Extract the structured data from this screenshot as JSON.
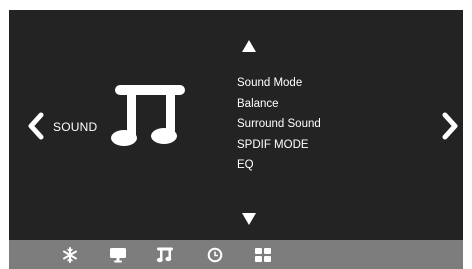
{
  "menu": {
    "section_label": "SOUND",
    "section_icon": "music-note-icon",
    "items": [
      {
        "label": "Sound Mode"
      },
      {
        "label": "Balance"
      },
      {
        "label": "Surround Sound"
      },
      {
        "label": "SPDIF MODE"
      },
      {
        "label": "EQ"
      }
    ]
  },
  "navigation": {
    "up_icon": "triangle-up-icon",
    "down_icon": "triangle-down-icon",
    "left_icon": "chevron-left-icon",
    "right_icon": "chevron-right-icon"
  },
  "bottom_bar": {
    "icons": [
      "snowflake-icon",
      "monitor-icon",
      "music-note-icon",
      "clock-icon",
      "grid-icon"
    ],
    "active": "music-note-icon"
  },
  "colors": {
    "screen_background": "#232323",
    "bottom_bar_background": "#7d7d7d",
    "text": "#ffffff"
  }
}
